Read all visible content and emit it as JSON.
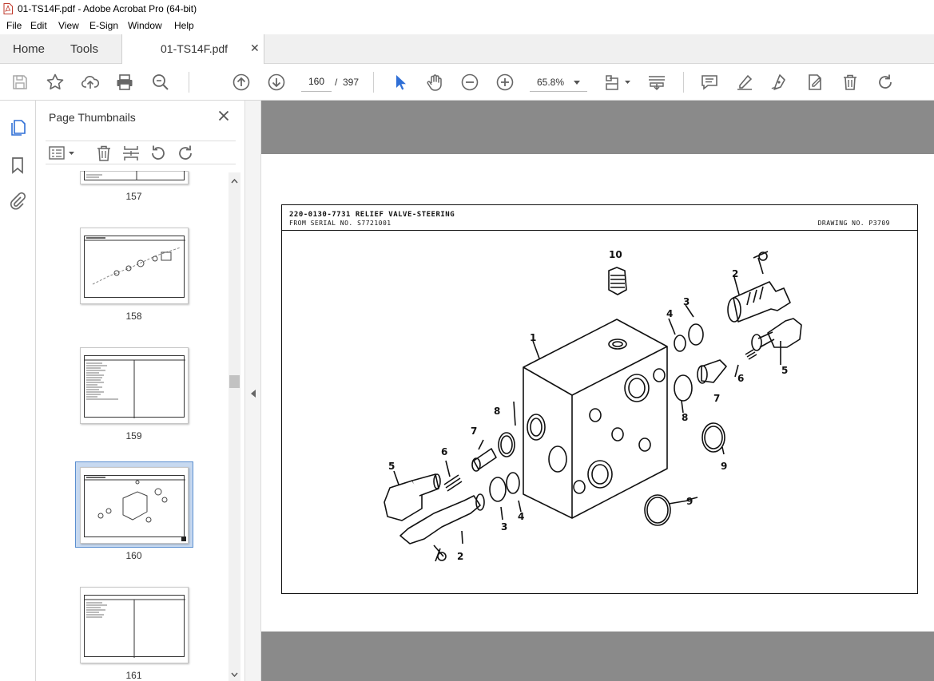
{
  "window": {
    "title": "01-TS14F.pdf - Adobe Acrobat Pro (64-bit)"
  },
  "menu": [
    "File",
    "Edit",
    "View",
    "E-Sign",
    "Window",
    "Help"
  ],
  "tabs": {
    "home": "Home",
    "tools": "Tools",
    "document": "01-TS14F.pdf",
    "close_glyph": "✕"
  },
  "toolbar": {
    "current_page": "160",
    "page_separator": "/",
    "total_pages": "397",
    "zoom": "65.8%"
  },
  "panel": {
    "title": "Page Thumbnails",
    "close_glyph": "✕",
    "thumbnails": [
      {
        "label": "157",
        "selected": false
      },
      {
        "label": "158",
        "selected": false
      },
      {
        "label": "159",
        "selected": false
      },
      {
        "label": "160",
        "selected": true
      },
      {
        "label": "161",
        "selected": false
      }
    ]
  },
  "document": {
    "title": "220-0130-7731  RELIEF VALVE-STEERING",
    "serial": "FROM SERIAL NO. S7721001",
    "drawing_no": "DRAWING NO. P3709",
    "callouts": [
      "1",
      "2",
      "2",
      "3",
      "3",
      "4",
      "4",
      "5",
      "5",
      "6",
      "6",
      "7",
      "7",
      "8",
      "8",
      "9",
      "9",
      "10"
    ]
  },
  "colors": {
    "accent": "#2f6fd6",
    "viewer_bg": "#8a8a8a",
    "icon": "#666666"
  }
}
